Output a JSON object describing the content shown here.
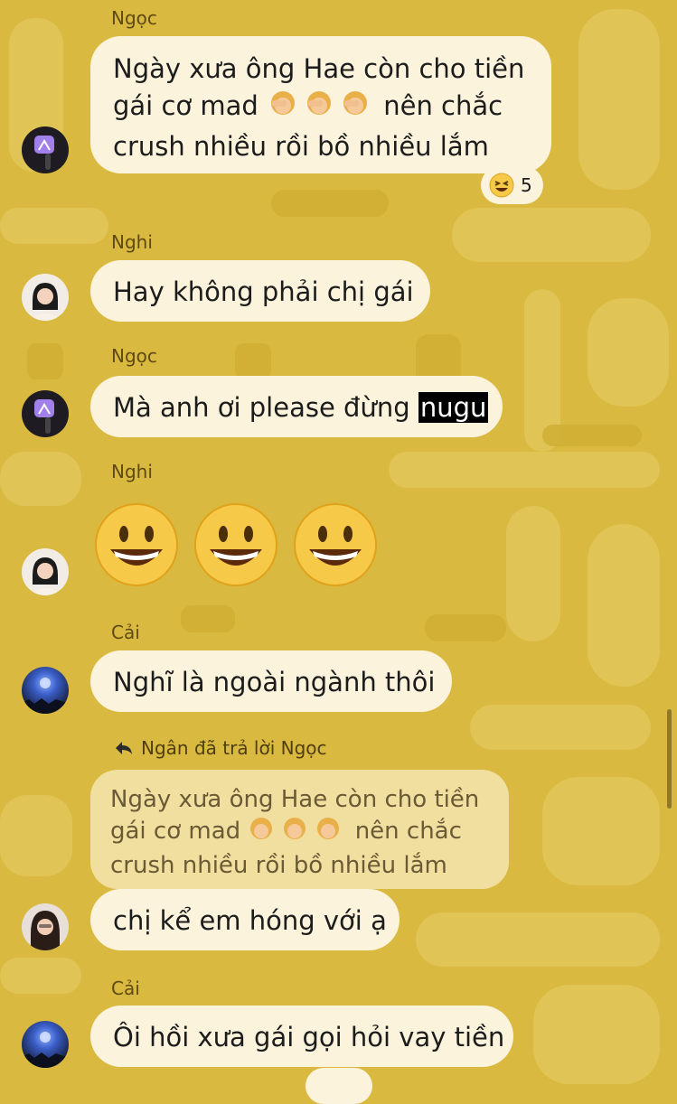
{
  "theme": {
    "background": "#d9b93f",
    "bubble": "#fbf3dc",
    "quote_bubble": "#f1df9f",
    "highlight": "#000000"
  },
  "messages": [
    {
      "sender": "Ngọc",
      "text_line1": "Ngày xưa ông Hae còn cho tiền",
      "text_line2_a": "gái cơ mad",
      "text_line2_b": "nên chắc",
      "text_line3": "crush nhiều rồi bồ nhiều lắm",
      "inline_emoji": "woman-facepalming x3",
      "reaction": {
        "emoji": "laughing-face",
        "count": "5"
      }
    },
    {
      "sender": "Nghi",
      "text": "Hay không phải chị gái"
    },
    {
      "sender": "Ngọc",
      "text_a": "Mà anh ơi please đừng",
      "text_highlight": "nugu"
    },
    {
      "sender": "Nghi",
      "emoji": "grinning-face x3"
    },
    {
      "sender": "Cải",
      "text": "Nghĩ là ngoài ngành thôi"
    },
    {
      "reply_label": "Ngân đã trả lời Ngọc",
      "quoted_line1": "Ngày xưa ông Hae còn cho tiền",
      "quoted_line2_a": "gái cơ mad",
      "quoted_line2_b": "nên chắc",
      "quoted_line3": "crush nhiều rồi bồ nhiều lắm",
      "text": "chị kể em hóng với ạ"
    },
    {
      "sender": "Cải",
      "text": "Ôi hồi xưa gái gọi hỏi vay tiền"
    }
  ]
}
